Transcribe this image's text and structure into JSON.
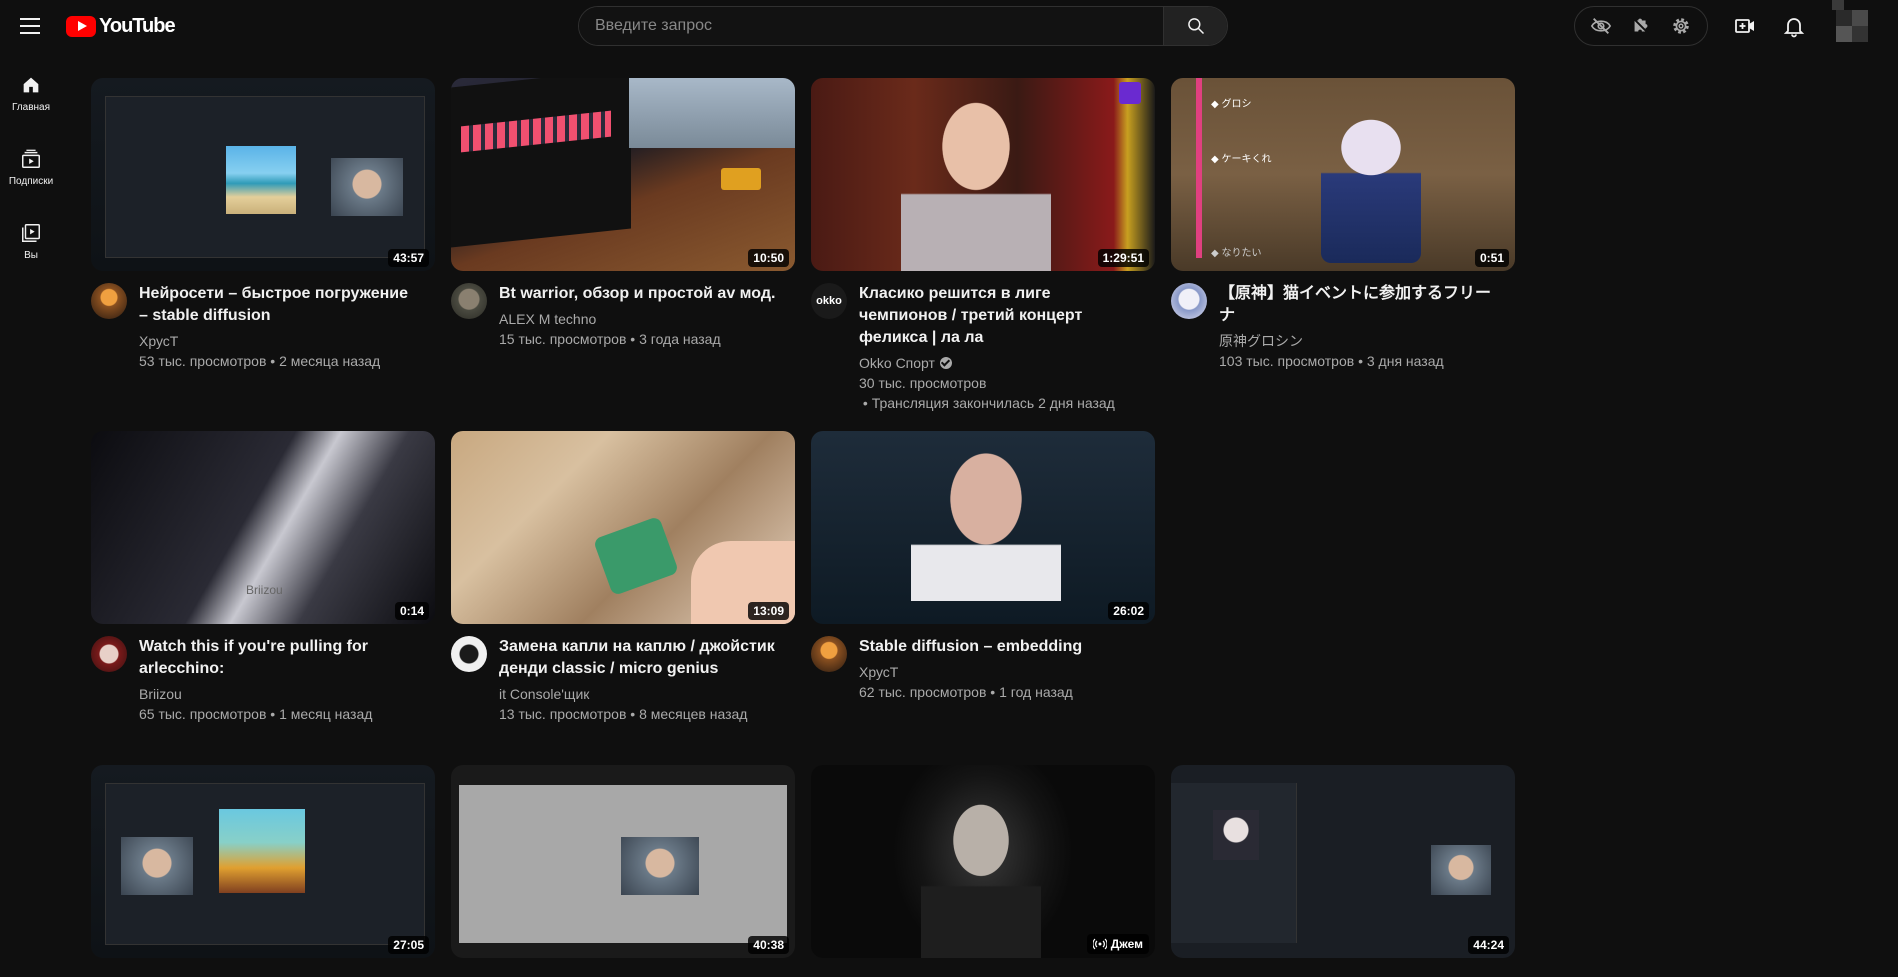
{
  "header": {
    "logo_text": "YouTube",
    "search_placeholder": "Введите запрос"
  },
  "sidebar": {
    "items": [
      {
        "label": "Главная",
        "icon": "home-icon"
      },
      {
        "label": "Подписки",
        "icon": "subscriptions-icon"
      },
      {
        "label": "Вы",
        "icon": "library-icon"
      }
    ]
  },
  "videos": [
    {
      "title": "Нейросети – быстрое погружение – stable diffusion",
      "channel": "ХрусТ",
      "views": "53 тыс. просмотров",
      "age": "2 месяца назад",
      "duration": "43:57"
    },
    {
      "title": "Bt warrior, обзор и простой av мод.",
      "channel": "ALEX M techno",
      "views": "15 тыс. просмотров",
      "age": "3 года назад",
      "duration": "10:50"
    },
    {
      "title": "Класико решится в лиге чемпионов / третий концерт феликса | ла ла",
      "channel": "Okko Спорт",
      "views": "30 тыс. просмотров",
      "age": "Трансляция закончилась 2 дня назад",
      "duration": "1:29:51",
      "channel_avatar_text": "okko"
    },
    {
      "title": "【原神】猫イベントに参加するフリーナ",
      "channel": "原神グロシン",
      "views": "103 тыс. просмотров",
      "age": "3 дня назад",
      "duration": "0:51",
      "thumb_texts": [
        "◆ グロシ",
        "◆ ケーキくれ",
        "◆ なりたい"
      ]
    },
    {
      "title": "Watch this if you're pulling for arlecchino:",
      "channel": "Briizou",
      "views": "65 тыс. просмотров",
      "age": "1 месяц назад",
      "duration": "0:14",
      "thumb_text": "Briizou"
    },
    {
      "title": "Замена капли на каплю / джойстик денди classic / micro genius",
      "channel": "it Console'щик",
      "views": "13 тыс. просмотров",
      "age": "8 месяцев назад",
      "duration": "13:09"
    },
    {
      "title": "Stable diffusion – embedding",
      "channel": "ХрусТ",
      "views": "62 тыс. просмотров",
      "age": "1 год назад",
      "duration": "26:02"
    },
    {
      "duration": "27:05"
    },
    {
      "duration": "40:38"
    },
    {
      "live_label": "Джем"
    },
    {
      "duration": "44:24"
    }
  ],
  "colors": {
    "background": "#0f0f0f",
    "brand_red": "#ff0000",
    "text_primary": "#f1f1f1",
    "text_secondary": "#aaaaaa"
  }
}
